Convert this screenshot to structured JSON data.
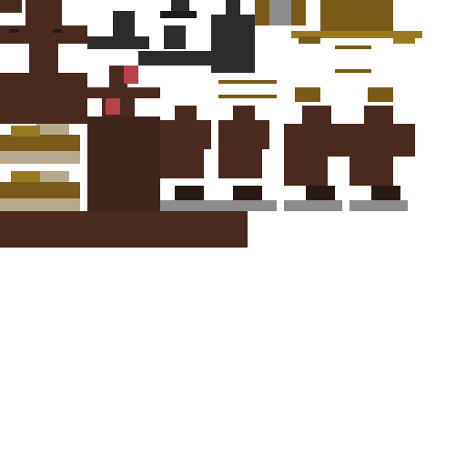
{
  "texture": {
    "palette": {
      "fur": "#4a2a1e",
      "fur_dark": "#3f2419",
      "hat": "#2c2c2c",
      "hat_dark": "#1c1c1c",
      "gold": "#7a5a18",
      "gold_light": "#9a7a20",
      "cream": "#b8a88c",
      "sole": "#8c8c8c",
      "cheek": "#b5424a",
      "shoe": "#2a1a14",
      "background": "#ffffff"
    }
  }
}
